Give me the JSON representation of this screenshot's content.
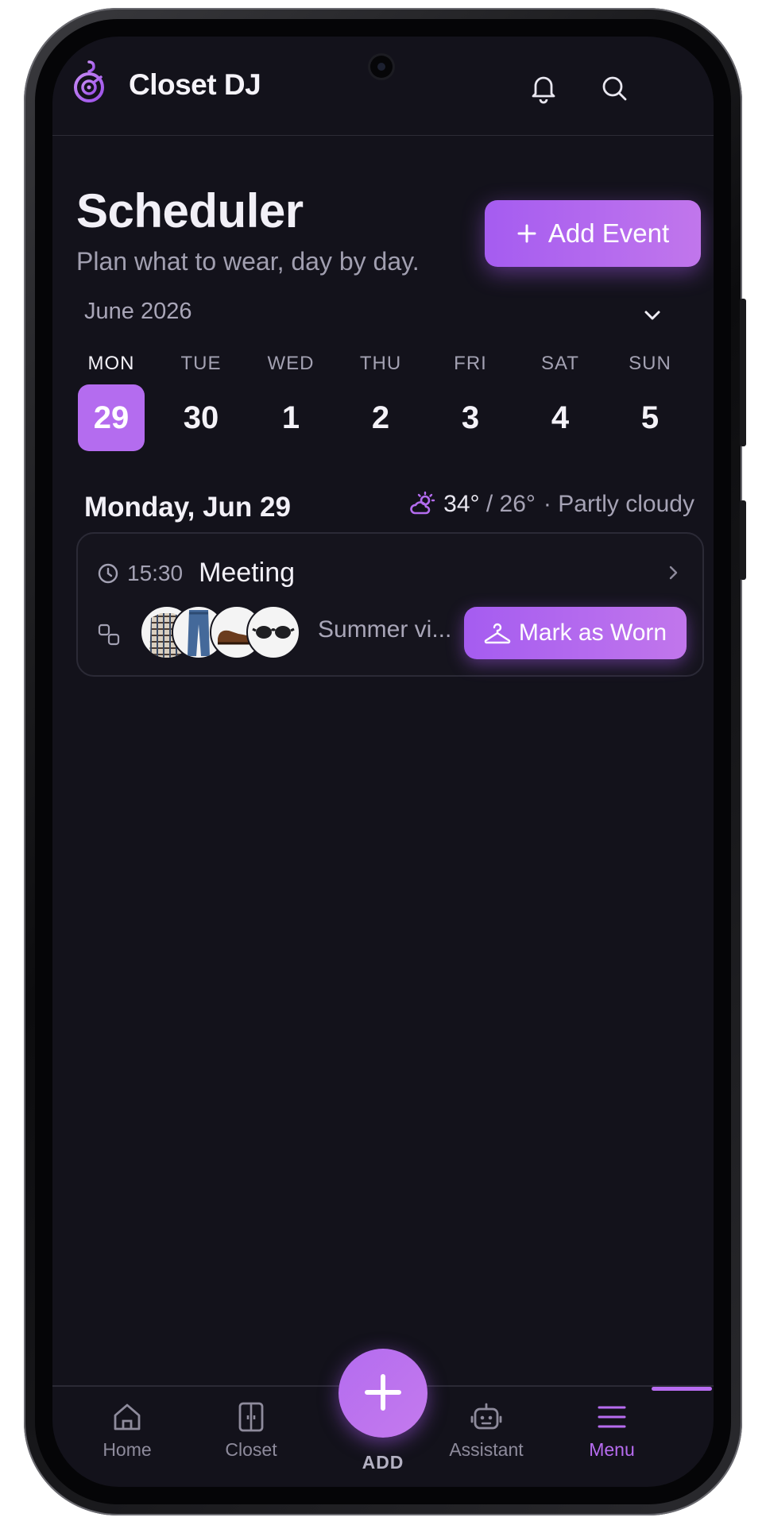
{
  "app": {
    "title": "Closet DJ"
  },
  "header": {
    "icons": [
      "bell-icon",
      "search-icon"
    ]
  },
  "page": {
    "title": "Scheduler",
    "subtitle": "Plan what to wear, day by day."
  },
  "actions": {
    "add_event_label": "Add Event"
  },
  "calendar": {
    "month_label": "June 2026",
    "days": [
      {
        "name": "MON",
        "date": "29",
        "selected": true
      },
      {
        "name": "TUE",
        "date": "30",
        "selected": false
      },
      {
        "name": "WED",
        "date": "1",
        "selected": false
      },
      {
        "name": "THU",
        "date": "2",
        "selected": false
      },
      {
        "name": "FRI",
        "date": "3",
        "selected": false
      },
      {
        "name": "SAT",
        "date": "4",
        "selected": false
      },
      {
        "name": "SUN",
        "date": "5",
        "selected": false
      }
    ]
  },
  "selected_day": {
    "heading": "Monday, Jun 29",
    "weather": {
      "high": "34°",
      "separator": "/",
      "low": "26°",
      "condition": "· Partly cloudy",
      "icon": "partly-cloudy-icon"
    }
  },
  "events": [
    {
      "time": "15:30",
      "title": "Meeting",
      "outfit_name": "Summer vi...",
      "outfit_items": [
        "shirt",
        "jeans",
        "shoes",
        "sunglasses"
      ],
      "action_label": "Mark as Worn"
    }
  ],
  "nav": {
    "items": [
      {
        "label": "Home",
        "icon": "home-icon"
      },
      {
        "label": "Closet",
        "icon": "closet-icon"
      },
      {
        "label": "ADD",
        "icon": "plus-icon"
      },
      {
        "label": "Assistant",
        "icon": "robot-icon"
      },
      {
        "label": "Menu",
        "icon": "menu-icon",
        "active": true
      }
    ]
  },
  "colors": {
    "accent": "#b46cef",
    "background": "#13121b",
    "text": "#f2f0f7",
    "muted": "#a3a1b2"
  }
}
